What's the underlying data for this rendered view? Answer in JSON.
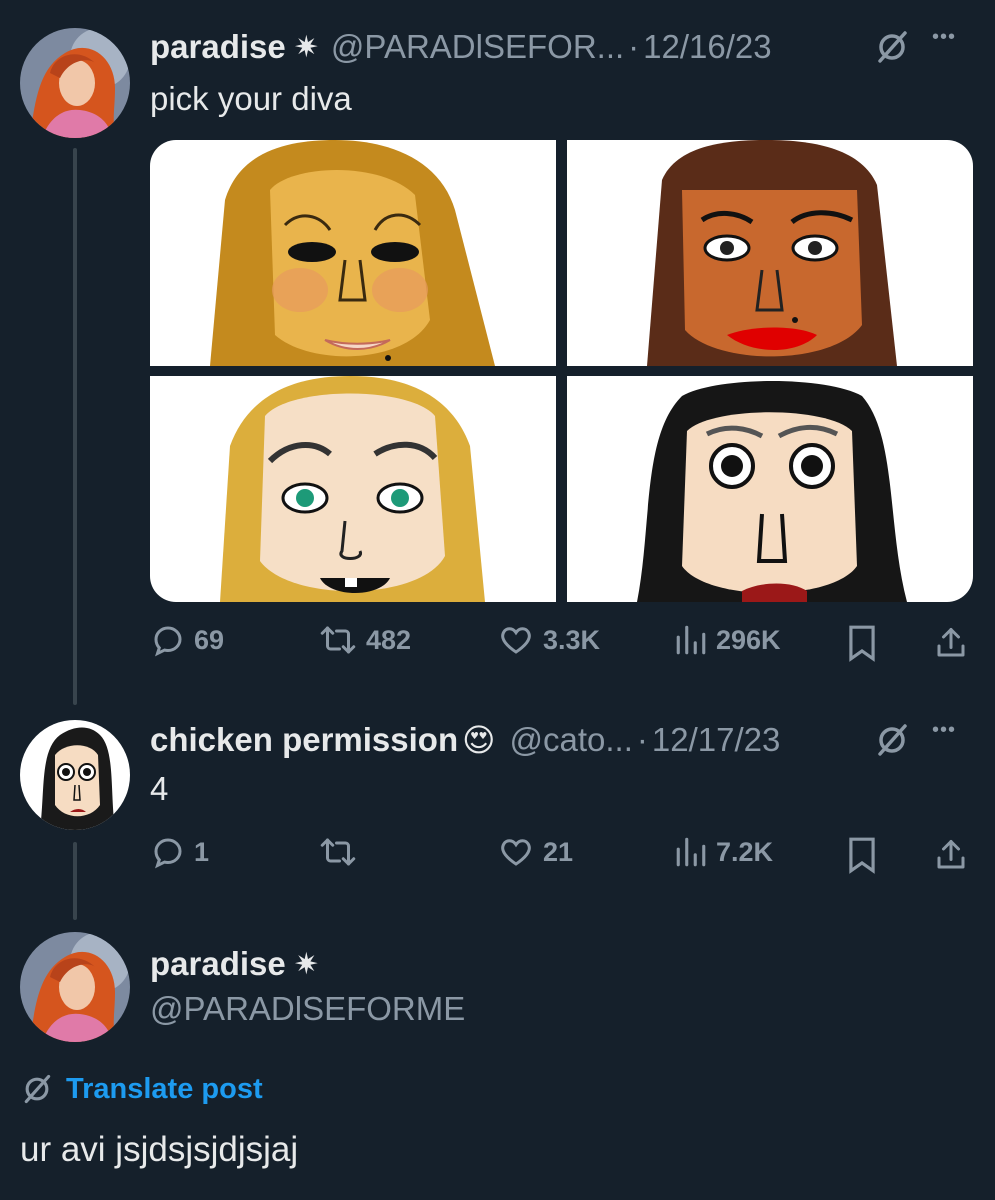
{
  "tweet1": {
    "display_name": "paradise",
    "badge": "✷",
    "handle": "@PARADlSEFOR...",
    "separator": "·",
    "date": "12/16/23",
    "text": "pick your diva",
    "actions": {
      "replies": "69",
      "reposts": "482",
      "likes": "3.3K",
      "views": "296K"
    }
  },
  "tweet2": {
    "display_name": "chicken permission",
    "emoji": "😍",
    "handle": "@cato...",
    "separator": "·",
    "date": "12/17/23",
    "text": "4",
    "actions": {
      "replies": "1",
      "reposts": "",
      "likes": "21",
      "views": "7.2K"
    }
  },
  "tweet3": {
    "display_name": "paradise",
    "badge": "✷",
    "handle": "@PARADlSEFORME",
    "translate_label": "Translate post",
    "text": "ur avi jsjdsjsjdjsjaj"
  },
  "more_glyph": "•••",
  "colors": {
    "background": "#15202b",
    "text": "#e7e9ea",
    "muted": "#8b98a5",
    "accent": "#1d9bf0",
    "thread_line": "#38444d"
  },
  "icons": [
    "grok-slash-icon",
    "more-icon",
    "reply-icon",
    "repost-icon",
    "like-icon",
    "views-icon",
    "bookmark-icon",
    "share-icon"
  ]
}
